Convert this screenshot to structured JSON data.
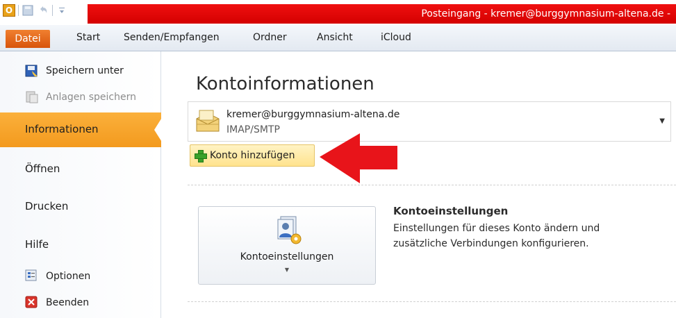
{
  "window": {
    "title": "Posteingang - kremer@burggymnasium-altena.de -",
    "app_icon_letter": "O",
    "title_bar_color": "#e30808"
  },
  "ribbon": {
    "tabs": [
      "Datei",
      "Start",
      "Senden/Empfangen",
      "Ordner",
      "Ansicht",
      "iCloud"
    ],
    "active_tab_color": "#e4661d"
  },
  "backstage": {
    "commands": [
      {
        "label": "Speichern unter",
        "icon": "save-as-icon",
        "enabled": true
      },
      {
        "label": "Anlagen speichern",
        "icon": "save-attachments-icon",
        "enabled": false
      }
    ],
    "nav": [
      "Informationen",
      "Öffnen",
      "Drucken",
      "Hilfe"
    ],
    "selected": "Informationen",
    "selected_color": "#f7a52b",
    "bottom_commands": [
      {
        "label": "Optionen",
        "icon": "options-icon"
      },
      {
        "label": "Beenden",
        "icon": "exit-icon"
      }
    ]
  },
  "main": {
    "title": "Kontoinformationen",
    "account": {
      "email": "kremer@burggymnasium-altena.de",
      "type": "IMAP/SMTP",
      "icon": "mailbox-icon"
    },
    "add_account_label": "Konto hinzufügen",
    "settings_button_label": "Kontoeinstellungen",
    "settings_heading": "Kontoeinstellungen",
    "settings_description": [
      "Einstellungen für dieses Konto ändern und",
      "zusätzliche Verbindungen konfigurieren."
    ],
    "annotation_arrow_color": "#e8141a"
  }
}
